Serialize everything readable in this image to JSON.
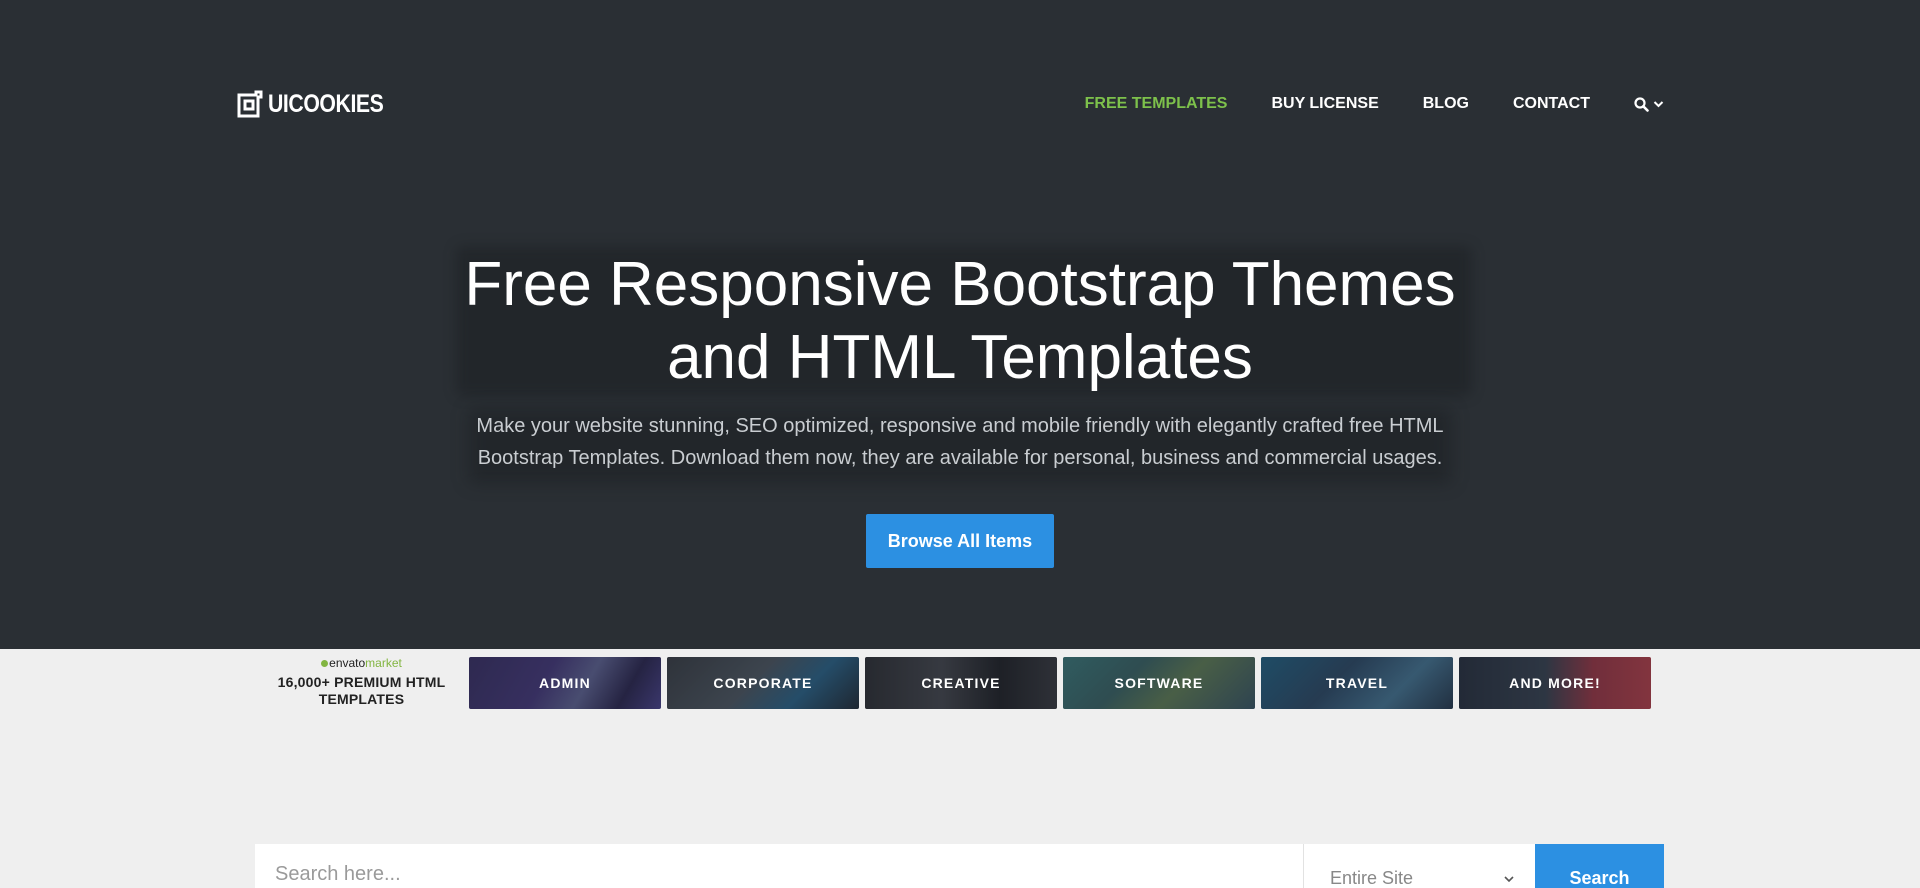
{
  "header": {
    "logo_text": "UICOOKIES",
    "nav": [
      {
        "label": "FREE TEMPLATES",
        "active": true
      },
      {
        "label": "BUY LICENSE",
        "active": false
      },
      {
        "label": "BLOG",
        "active": false
      },
      {
        "label": "CONTACT",
        "active": false
      }
    ],
    "search_icon": "search-icon",
    "dropdown_icon": "chevron-down-icon"
  },
  "hero": {
    "title_line1": "Free Responsive Bootstrap Themes",
    "title_line2": "and HTML Templates",
    "subtitle_line1": "Make your website stunning, SEO optimized, responsive and mobile friendly with elegantly crafted free HTML",
    "subtitle_line2": "Bootstrap Templates. Download them now, they are available for personal, business and commercial usages.",
    "cta_label": "Browse All Items"
  },
  "promo": {
    "brand_prefix": "envato",
    "brand_suffix": "market",
    "title_line1": "16,000+ PREMIUM HTML",
    "title_line2": "TEMPLATES",
    "tiles": [
      {
        "label": "ADMIN"
      },
      {
        "label": "CORPORATE"
      },
      {
        "label": "CREATIVE"
      },
      {
        "label": "SOFTWARE"
      },
      {
        "label": "TRAVEL"
      },
      {
        "label": "AND MORE!"
      }
    ]
  },
  "search": {
    "placeholder": "Search here...",
    "scope_value": "Entire Site",
    "button_label": "Search"
  },
  "colors": {
    "hero_bg": "#2a2f34",
    "page_bg": "#efefef",
    "accent_blue": "#2c90e2",
    "nav_active": "#7dc14b",
    "envato_green": "#82b541"
  }
}
